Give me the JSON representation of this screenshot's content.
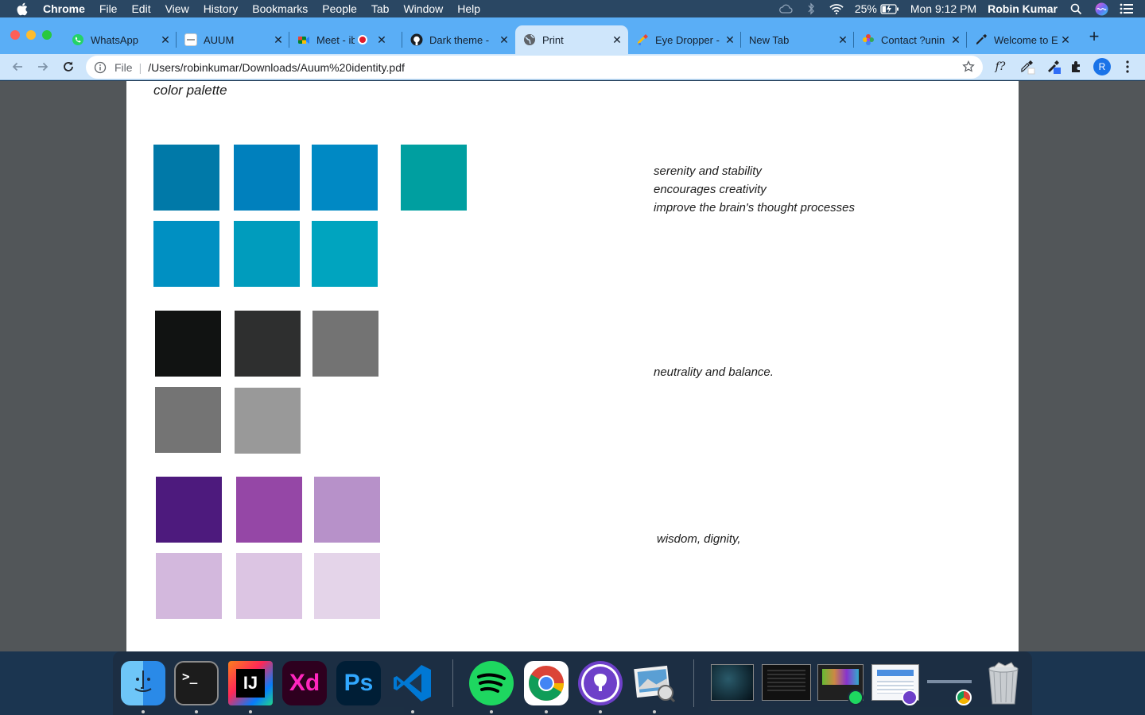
{
  "menubar": {
    "items": [
      "Chrome",
      "File",
      "Edit",
      "View",
      "History",
      "Bookmarks",
      "People",
      "Tab",
      "Window",
      "Help"
    ],
    "battery": "25%",
    "clock": "Mon 9:12 PM",
    "user": "Robin Kumar"
  },
  "tabs": [
    {
      "title": "WhatsApp",
      "icon": "whatsapp-icon"
    },
    {
      "title": "AUUM",
      "icon": "document-icon"
    },
    {
      "title": "Meet - ibp",
      "icon": "meet-icon"
    },
    {
      "title": "Dark theme -",
      "icon": "github-icon"
    },
    {
      "title": "Print",
      "icon": "globe-icon"
    },
    {
      "title": "Eye Dropper -",
      "icon": "eyedropper-icon"
    },
    {
      "title": "New Tab",
      "icon": "none"
    },
    {
      "title": "Contact ?unin",
      "icon": "color-wheel-icon"
    },
    {
      "title": "Welcome to E",
      "icon": "eyedropper-icon"
    }
  ],
  "toolbar": {
    "scheme": "File",
    "url": "/Users/robinkumar/Downloads/Auum%20identity.pdf",
    "profile_initial": "R",
    "font_ext_label": "f?"
  },
  "pdf": {
    "heading": "color palette",
    "groups": [
      {
        "name": "blues",
        "colors": [
          "#0079a8",
          "#0080bd",
          "#0089c4",
          "#009fa0",
          "#0090c2",
          "#009cbd",
          "#00a4bf"
        ],
        "lines": [
          "serenity and stability",
          "encourages creativity",
          "improve the brain's thought processes"
        ]
      },
      {
        "name": "greys",
        "colors": [
          "#111312",
          "#2e2f2f",
          "#737373",
          "#747474",
          "#999999"
        ],
        "lines": [
          "neutrality and balance."
        ]
      },
      {
        "name": "purples",
        "colors": [
          "#4d1a7d",
          "#9547a6",
          "#b791c9",
          "#d3b8dd",
          "#dcc5e3",
          "#e4d4e9"
        ],
        "lines": [
          "wisdom, dignity,"
        ]
      }
    ]
  },
  "dock": {
    "apps": [
      "Finder",
      "Terminal",
      "IntelliJ IDEA",
      "Adobe XD",
      "Photoshop",
      "Visual Studio Code",
      "Spotify",
      "Chrome",
      "GitHub Desktop",
      "Preview"
    ],
    "labels": {
      "terminal": ">_",
      "intellij": "IJ",
      "xd": "Xd",
      "ps": "Ps"
    }
  }
}
